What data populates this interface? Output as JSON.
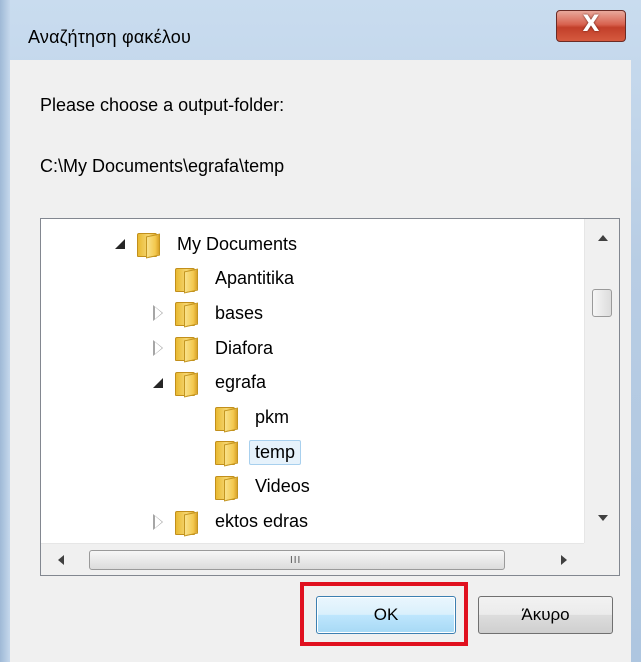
{
  "window": {
    "title": "Αναζήτηση φακέλου",
    "close_label": "X"
  },
  "dialog": {
    "prompt": "Please choose a output-folder:",
    "path": "C:\\My Documents\\egrafa\\temp"
  },
  "tree": {
    "items": [
      {
        "label": "My Documents",
        "expander": "expanded",
        "level": 0,
        "selected": false
      },
      {
        "label": "Apantitika",
        "expander": "none",
        "level": 1,
        "selected": false
      },
      {
        "label": "bases",
        "expander": "collapsed",
        "level": 1,
        "selected": false
      },
      {
        "label": "Diafora",
        "expander": "collapsed",
        "level": 1,
        "selected": false
      },
      {
        "label": "egrafa",
        "expander": "expanded",
        "level": 1,
        "selected": false
      },
      {
        "label": "pkm",
        "expander": "none",
        "level": 2,
        "selected": false
      },
      {
        "label": "temp",
        "expander": "none",
        "level": 2,
        "selected": true
      },
      {
        "label": "Videos",
        "expander": "none",
        "level": 2,
        "selected": false
      },
      {
        "label": "ektos edras",
        "expander": "collapsed",
        "level": 1,
        "selected": false
      }
    ],
    "hscroll_grip": "III"
  },
  "buttons": {
    "ok_label": "OK",
    "cancel_label": "Άκυρο"
  },
  "colors": {
    "highlight": "#e0101f",
    "selection_bg": "#e6f2fb",
    "selection_border": "#a8d0ee"
  }
}
